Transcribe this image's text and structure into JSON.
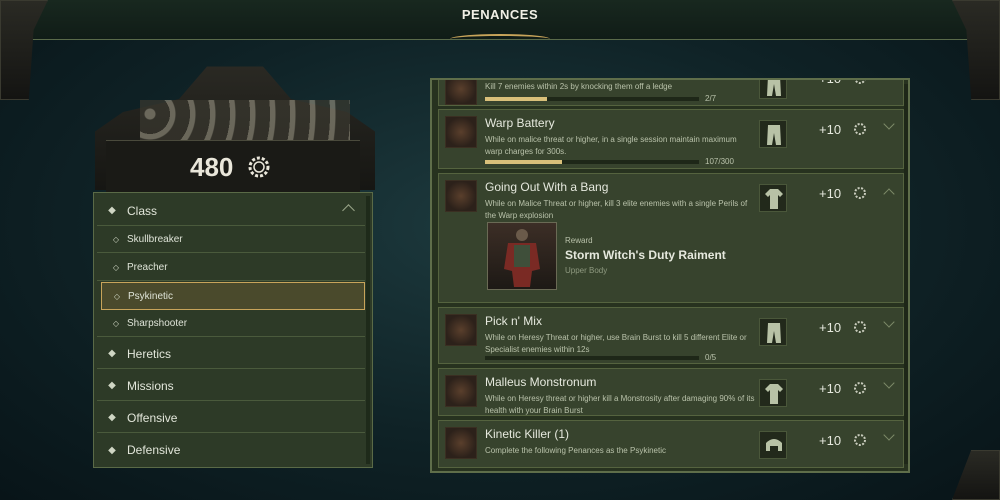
{
  "header": {
    "title": "PENANCES"
  },
  "score": {
    "value": "480"
  },
  "categories": [
    {
      "label": "Class",
      "expanded": true
    },
    {
      "label": "Heretics"
    },
    {
      "label": "Missions"
    },
    {
      "label": "Offensive"
    },
    {
      "label": "Defensive"
    }
  ],
  "classes": [
    {
      "label": "Skullbreaker"
    },
    {
      "label": "Preacher"
    },
    {
      "label": "Psykinetic",
      "selected": true
    },
    {
      "label": "Sharpshooter"
    }
  ],
  "penances": [
    {
      "title": "",
      "desc": "Kill 7 enemies within 2s by knocking them off a ledge",
      "progress_text": "2/7",
      "progress": 0.29,
      "points": "+10",
      "gear": "pants-icon"
    },
    {
      "title": "Warp Battery",
      "desc": "While on malice threat or higher, in a single session maintain maximum warp charges for 300s.",
      "progress_text": "107/300",
      "progress": 0.36,
      "points": "+10",
      "gear": "pants-icon"
    },
    {
      "title": "Going Out With a Bang",
      "desc": "While on Malice Threat or higher, kill 3 elite enemies with a single Perils of the Warp explosion",
      "points": "+10",
      "gear": "shirt-icon",
      "expanded": true,
      "reward": {
        "label": "Reward",
        "name": "Storm Witch's Duty Raiment",
        "slot": "Upper Body"
      }
    },
    {
      "title": "Pick n' Mix",
      "desc": "While on Heresy Threat or higher, use Brain Burst to kill 5 different Elite or Specialist enemies within 12s",
      "progress_text": "0/5",
      "progress": 0,
      "points": "+10",
      "gear": "pants-icon"
    },
    {
      "title": "Malleus Monstronum",
      "desc": "While on Heresy threat or higher kill a Monstrosity after damaging 90% of its health with your Brain Burst",
      "points": "+10",
      "gear": "shirt-icon"
    },
    {
      "title": "Kinetic Killer (1)",
      "desc": "Complete the following Penances as the Psykinetic",
      "points": "+10",
      "gear": "shoulder-icon"
    }
  ],
  "colors": {
    "accent": "#c8a45a",
    "panel": "#37432d",
    "progress": "#d9c07a"
  }
}
